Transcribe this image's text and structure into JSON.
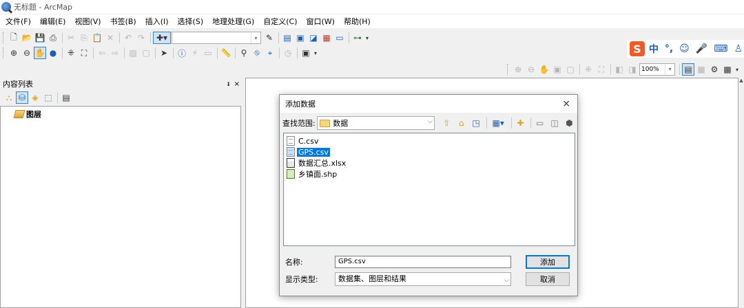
{
  "window": {
    "title": "无标题 - ArcMap"
  },
  "menubar": {
    "items": [
      "文件(F)",
      "编辑(E)",
      "视图(V)",
      "书签(B)",
      "插入(I)",
      "选择(S)",
      "地理处理(G)",
      "自定义(C)",
      "窗口(W)",
      "帮助(H)"
    ]
  },
  "toolbar": {
    "zoom_value": "100%",
    "icons_row1": [
      "new-doc-icon",
      "open-icon",
      "save-icon",
      "print-icon",
      "cut-icon",
      "copy-icon",
      "paste-icon",
      "delete-icon",
      "undo-icon",
      "redo-icon",
      "add-data-icon"
    ],
    "icons_row2": [
      "zoom-in-icon",
      "zoom-out-icon",
      "pan-icon",
      "full-extent-icon"
    ]
  },
  "ime": {
    "logo": "S",
    "mode": "中"
  },
  "toc": {
    "title": "内容列表",
    "pin": "ᵻ",
    "close": "×",
    "layer_label": "图层"
  },
  "dialog": {
    "title": "添加数据",
    "close": "×",
    "lookin_label": "查找范围:",
    "lookin_value": "数据",
    "files": [
      {
        "name": "C.csv",
        "type": "doc",
        "selected": false
      },
      {
        "name": "GPS.csv",
        "type": "doc",
        "selected": true
      },
      {
        "name": "数据汇总.xlsx",
        "type": "sheet",
        "selected": false
      },
      {
        "name": "乡镇面.shp",
        "type": "shp",
        "selected": false
      }
    ],
    "name_label": "名称:",
    "name_value": "GPS.csv",
    "add_button": "添加",
    "type_label": "显示类型:",
    "type_value": "数据集、图层和结果",
    "cancel_button": "取消"
  }
}
